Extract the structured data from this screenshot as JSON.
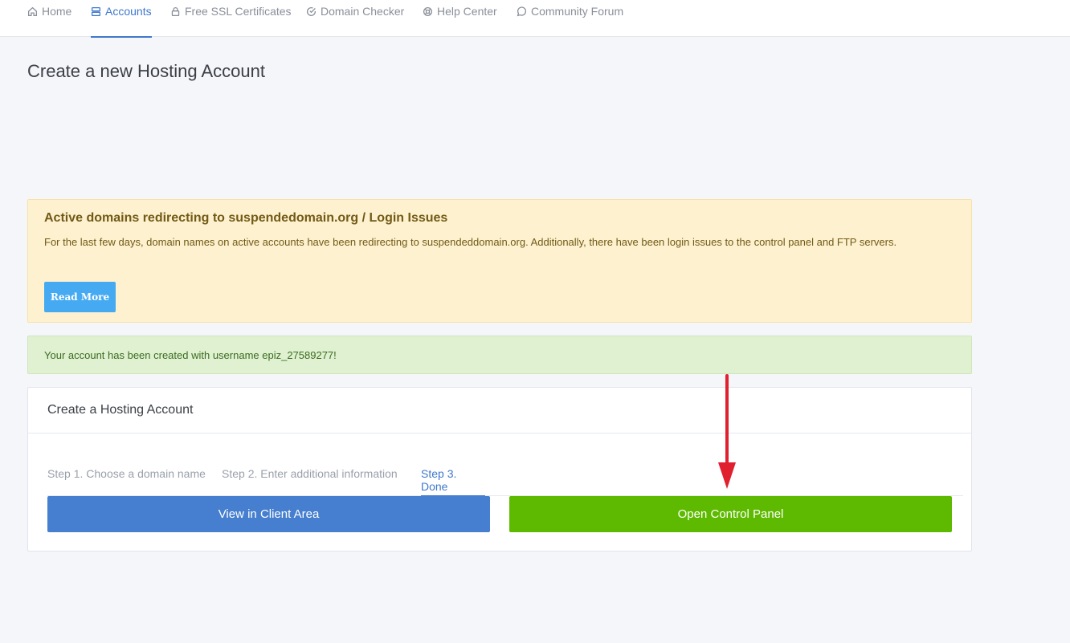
{
  "nav": {
    "items": [
      {
        "label": "Home",
        "icon": "home-icon"
      },
      {
        "label": "Accounts",
        "icon": "server-icon",
        "active": true
      },
      {
        "label": "Free SSL Certificates",
        "icon": "lock-icon"
      },
      {
        "label": "Domain Checker",
        "icon": "check-circle-icon"
      },
      {
        "label": "Help Center",
        "icon": "lifebuoy-icon"
      },
      {
        "label": "Community Forum",
        "icon": "chat-icon"
      }
    ]
  },
  "page": {
    "title": "Create a new Hosting Account"
  },
  "warning": {
    "title": "Active domains redirecting to suspendedomain.org / Login Issues",
    "body": "For the last few days, domain names on active accounts have been redirecting to suspendeddomain.org. Additionally, there have been login issues to the control panel and FTP servers.",
    "button": "Read More"
  },
  "success": {
    "message": "Your account has been created with username epiz_27589277!"
  },
  "card": {
    "title": "Create a Hosting Account",
    "steps": [
      {
        "label": "Step 1. Choose a domain name"
      },
      {
        "label": "Step 2. Enter additional information"
      },
      {
        "label": "Step 3. Done",
        "active": true
      }
    ],
    "client_button": "View in Client Area",
    "panel_button": "Open Control Panel"
  },
  "colors": {
    "accent": "#467fcf",
    "success": "#5eba00",
    "info": "#45aaf2",
    "warning_bg": "#fdf1cf",
    "success_bg": "#dff1d0",
    "annotation_arrow": "#e0202e"
  }
}
